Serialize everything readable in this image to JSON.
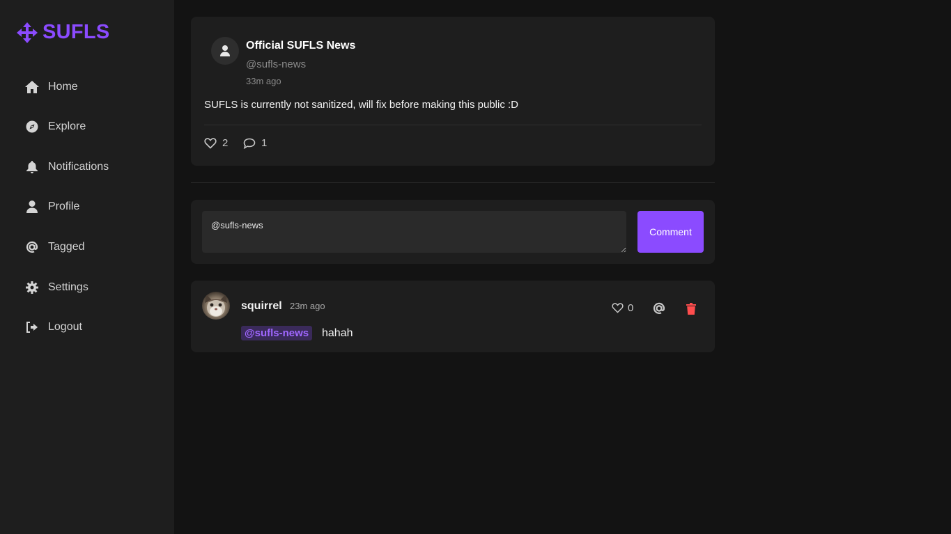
{
  "brand": {
    "name": "SUFLS",
    "color": "#8b4bff",
    "icon": "arrows-move-icon"
  },
  "nav": [
    {
      "label": "Home",
      "icon": "home-icon"
    },
    {
      "label": "Explore",
      "icon": "compass-icon"
    },
    {
      "label": "Notifications",
      "icon": "bell-icon"
    },
    {
      "label": "Profile",
      "icon": "user-icon"
    },
    {
      "label": "Tagged",
      "icon": "at-icon"
    },
    {
      "label": "Settings",
      "icon": "gear-icon"
    },
    {
      "label": "Logout",
      "icon": "logout-icon"
    }
  ],
  "post": {
    "author": "Official SUFLS News",
    "handle": "@sufls-news",
    "time": "33m ago",
    "body": "SUFLS is currently not sanitized, will fix before making this public :D",
    "likes": "2",
    "comments": "1"
  },
  "comment_form": {
    "value": "@sufls-news",
    "button_label": "Comment"
  },
  "reply": {
    "author": "squirrel",
    "time": "23m ago",
    "mention": "@sufls-news",
    "text": "hahah",
    "likes": "0",
    "delete_color": "#ff4d4d"
  }
}
